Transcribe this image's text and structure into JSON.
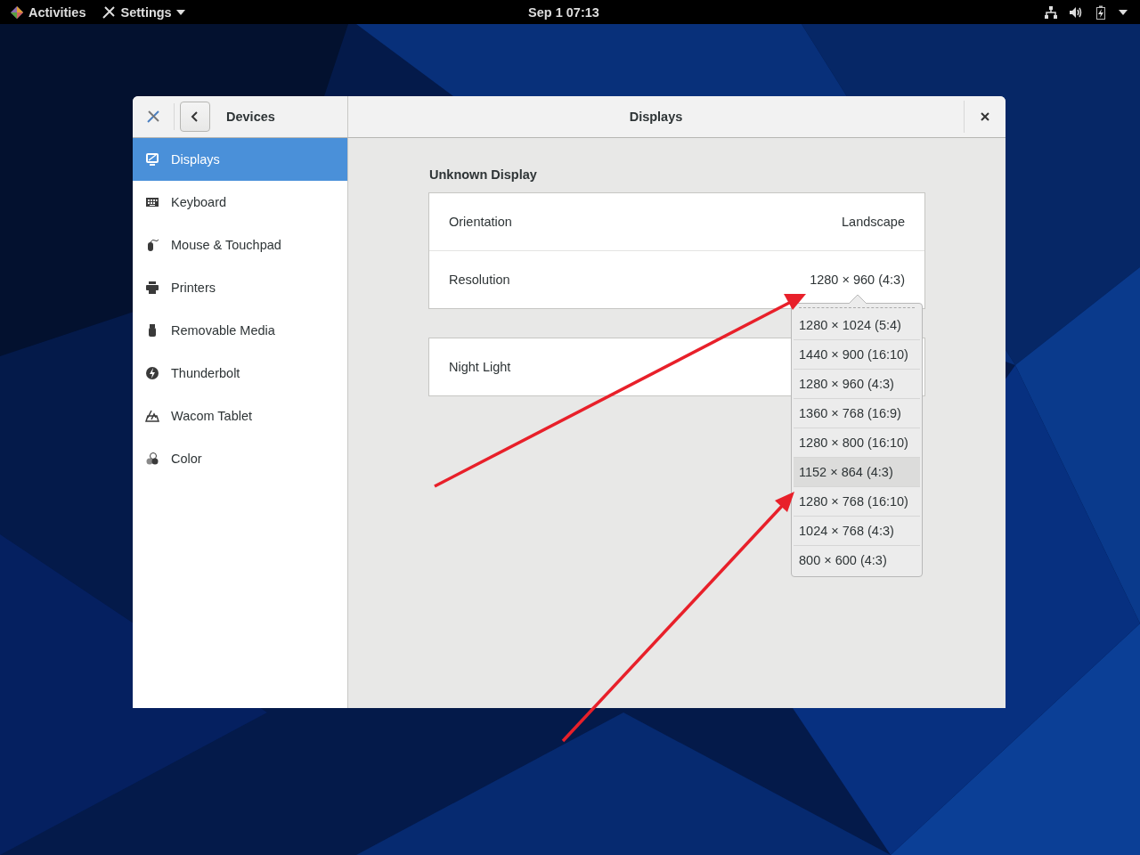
{
  "top_bar": {
    "activities": "Activities",
    "app_menu": "Settings",
    "clock": "Sep 1  07:13"
  },
  "window": {
    "panel_title": "Devices",
    "title": "Displays"
  },
  "sidebar": {
    "items": [
      {
        "label": "Displays",
        "selected": true
      },
      {
        "label": "Keyboard",
        "selected": false
      },
      {
        "label": "Mouse & Touchpad",
        "selected": false
      },
      {
        "label": "Printers",
        "selected": false
      },
      {
        "label": "Removable Media",
        "selected": false
      },
      {
        "label": "Thunderbolt",
        "selected": false
      },
      {
        "label": "Wacom Tablet",
        "selected": false
      },
      {
        "label": "Color",
        "selected": false
      }
    ]
  },
  "display": {
    "name": "Unknown Display",
    "rows": [
      {
        "label": "Orientation",
        "value": "Landscape"
      },
      {
        "label": "Resolution",
        "value": "1280 × 960 (4:3)"
      }
    ],
    "night_light": {
      "label": "Night Light"
    }
  },
  "resolution_menu": {
    "options": [
      {
        "label": "1280 × 1024 (5:4)",
        "hovered": false
      },
      {
        "label": "1440 × 900 (16:10)",
        "hovered": false
      },
      {
        "label": "1280 × 960 (4:3)",
        "hovered": false
      },
      {
        "label": "1360 × 768 (16:9)",
        "hovered": false
      },
      {
        "label": "1280 × 800 (16:10)",
        "hovered": false
      },
      {
        "label": "1152 × 864 (4:3)",
        "hovered": true
      },
      {
        "label": "1280 × 768 (16:10)",
        "hovered": false
      },
      {
        "label": "1024 × 768 (4:3)",
        "hovered": false
      },
      {
        "label": "800 × 600 (4:3)",
        "hovered": false
      }
    ]
  }
}
